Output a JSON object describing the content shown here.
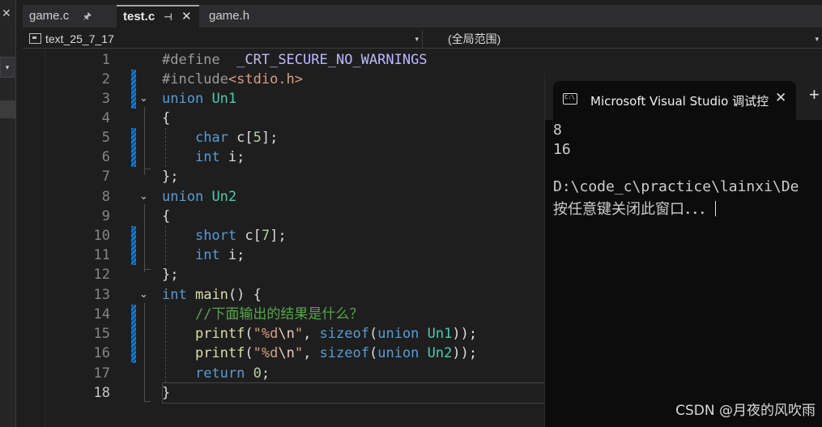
{
  "left_panel": {
    "close_glyph": "✕",
    "dropdown_glyph": "▾"
  },
  "tabs": [
    {
      "label": "game.c",
      "pin": "🖈"
    },
    {
      "label": "test.c",
      "pin": "⊣",
      "close": "✕"
    },
    {
      "label": "game.h"
    }
  ],
  "navbar": {
    "project": "text_25_7_17",
    "scope": "(全局范围)",
    "arrow": "▾"
  },
  "editor": {
    "line_numbers": [
      "1",
      "2",
      "3",
      "4",
      "5",
      "6",
      "7",
      "8",
      "9",
      "10",
      "11",
      "12",
      "13",
      "14",
      "15",
      "16",
      "17",
      "18"
    ],
    "active_line": "18",
    "fold_glyph": "⌄"
  },
  "code": {
    "l1": {
      "kw": "#define",
      "macro": "_CRT_SECURE_NO_WARNINGS"
    },
    "l2": {
      "kw": "#include",
      "hdr": "<stdio.h>"
    },
    "l3": {
      "kw": "union",
      "name": "Un1"
    },
    "l4": "{",
    "l5": {
      "type": "char",
      "name": "c",
      "open": "[",
      "num": "5",
      "close": "];"
    },
    "l6": {
      "type": "int",
      "name": "i",
      "end": ";"
    },
    "l7": "};",
    "l8": {
      "kw": "union",
      "name": "Un2"
    },
    "l9": "{",
    "l10": {
      "type": "short",
      "name": "c",
      "open": "[",
      "num": "7",
      "close": "];"
    },
    "l11": {
      "type": "int",
      "name": "i",
      "end": ";"
    },
    "l12": "};",
    "l13": {
      "type": "int",
      "fn": "main",
      "rest": "() {"
    },
    "l14": "//下面输出的结果是什么？",
    "l15": {
      "fn": "printf",
      "open": "(",
      "str_a": "\"%d",
      "esc": "\\n",
      "str_b": "\"",
      "comma": ", ",
      "kw": "sizeof",
      "p1": "(",
      "kw2": "union",
      "name": "Un1",
      "p2": "));"
    },
    "l16": {
      "fn": "printf",
      "open": "(",
      "str_a": "\"%d",
      "esc": "\\n",
      "str_b": "\"",
      "comma": ", ",
      "kw": "sizeof",
      "p1": "(",
      "kw2": "union",
      "name": "Un2",
      "p2": "));"
    },
    "l17": {
      "kw": "return",
      "num": "0",
      "end": ";"
    },
    "l18": "}"
  },
  "console": {
    "title": "Microsoft Visual Studio 调试控",
    "close": "✕",
    "plus": "+",
    "output": [
      "8",
      "16",
      "",
      "D:\\code_c\\practice\\lainxi\\De",
      "按任意键关闭此窗口．．．"
    ]
  },
  "watermark": "CSDN @月夜的风吹雨",
  "colors": {
    "background": "#1e1e1e",
    "keyword": "#569cd6",
    "type_name": "#4ec9b0",
    "function": "#dcdcaa",
    "string": "#d69d85",
    "comment": "#57a64a",
    "change_marker": "#1b80d8",
    "console_bg": "#0c0c0c"
  }
}
